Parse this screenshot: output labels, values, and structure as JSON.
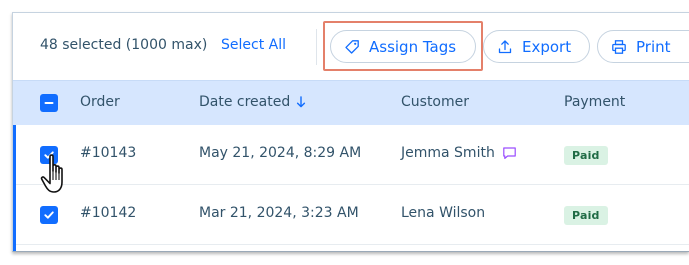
{
  "toolbar": {
    "selection_count": "48 selected (1000 max)",
    "select_all_label": "Select All",
    "assign_tags_label": "Assign Tags",
    "assign_tags_icon": "tag-icon",
    "export_label": "Export",
    "export_icon": "upload-icon",
    "print_label": "Print",
    "print_icon": "printer-icon"
  },
  "table": {
    "columns": {
      "order": "Order",
      "date_created": "Date created",
      "customer": "Customer",
      "payment": "Payment"
    },
    "sort_icon": "arrow-down-icon",
    "rows": [
      {
        "order": "#10143",
        "date": "May 21, 2024, 8:29 AM",
        "customer": "Jemma Smith",
        "has_message": true,
        "payment": "Paid",
        "checked": true
      },
      {
        "order": "#10142",
        "date": "Mar 21, 2024, 3:23 AM",
        "customer": "Lena Wilson",
        "has_message": false,
        "payment": "Paid",
        "checked": true
      }
    ]
  },
  "colors": {
    "accent": "#116dff",
    "header_bg": "#d6e6fe",
    "paid_badge_bg": "#daf2e4",
    "paid_badge_text": "#1f6b45",
    "highlight_border": "#e4806a",
    "message_icon": "#9a4dff"
  }
}
